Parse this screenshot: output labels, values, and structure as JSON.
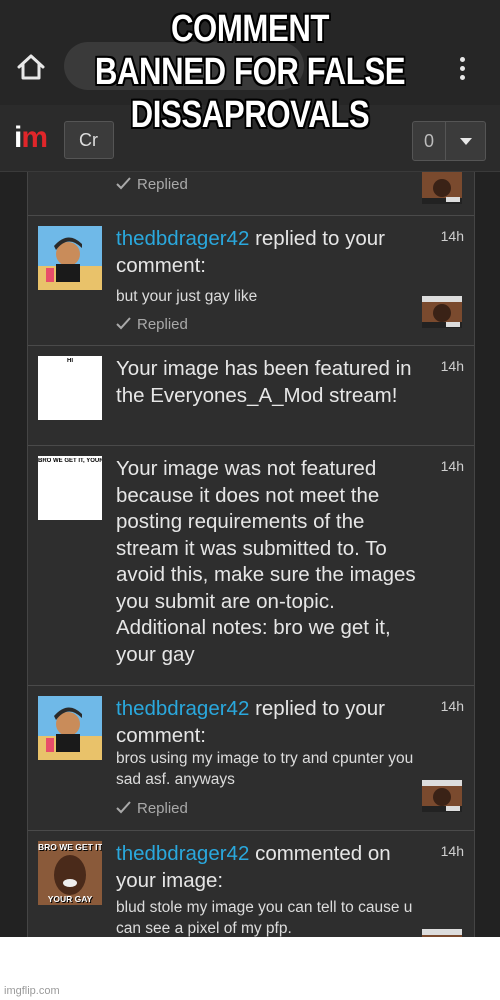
{
  "meme": {
    "caption_line1": "COMMENT",
    "caption_line2": "BANNED FOR FALSE",
    "caption_line3": "DISSAPROVALS"
  },
  "site_nav": {
    "logo_i": "i",
    "logo_m": "m",
    "create_label": "Cr",
    "notif_count": "0"
  },
  "notifications": [
    {
      "replied_label": "Replied"
    },
    {
      "username": "thedbdrager42",
      "action": " replied to your comment:",
      "time": "14h",
      "text": "but your just gay like",
      "replied_label": "Replied"
    },
    {
      "message": "Your image has been featured in the Everyones_A_Mod stream!",
      "time": "14h",
      "thumb_text": "HI"
    },
    {
      "message": "Your image was not featured because it does not meet the posting requirements of the stream it was submitted to. To avoid this, make sure the images you submit are on-topic. Additional notes: bro we get it, your gay",
      "time": "14h",
      "thumb_text": "BRO WE GET IT, YOUR GAY"
    },
    {
      "username": "thedbdrager42",
      "action": " replied to your comment:",
      "time": "14h",
      "text": "bros using my image to try and cpunter you sad asf. anyways",
      "replied_label": "Replied"
    },
    {
      "username": "thedbdrager42",
      "action": " commented on your image:",
      "time": "14h",
      "text": "blud stole my image you can tell to cause u can see a pixel of my pfp.",
      "avatar_top_text": "BRO WE GET IT",
      "avatar_bottom_text": "YOUR GAY"
    }
  ],
  "watermark": "imgflip.com",
  "colors": {
    "username": "#2aa8dd",
    "logo_m": "#e0262a",
    "background": "#222222"
  }
}
